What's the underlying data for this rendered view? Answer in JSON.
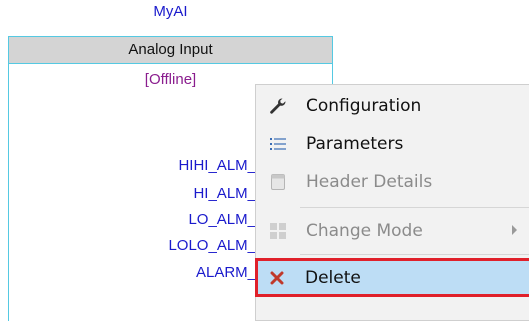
{
  "block": {
    "name": "MyAI",
    "type": "Analog Input",
    "status": "[Offline]",
    "ports": [
      "HIHI_ALM_",
      "HI_ALM_",
      "LO_ALM_",
      "LOLO_ALM_",
      "ALARM_"
    ]
  },
  "context_menu": {
    "items": [
      {
        "label": "Configuration",
        "icon": "wrench-icon",
        "enabled": true
      },
      {
        "label": "Parameters",
        "icon": "list-icon",
        "enabled": true
      },
      {
        "label": "Header Details",
        "icon": "document-icon",
        "enabled": false
      },
      {
        "label": "Change Mode",
        "icon": "grid-icon",
        "enabled": false,
        "has_submenu": true
      },
      {
        "label": "Delete",
        "icon": "delete-x-icon",
        "enabled": true,
        "selected": true
      }
    ]
  },
  "colors": {
    "block_name": "#1a1acc",
    "block_border": "#55c9e2",
    "status": "#8a1d8e",
    "delete_icon": "#c0392b",
    "selection_outline": "#e0202a",
    "selection_fill": "#bdddf5"
  }
}
